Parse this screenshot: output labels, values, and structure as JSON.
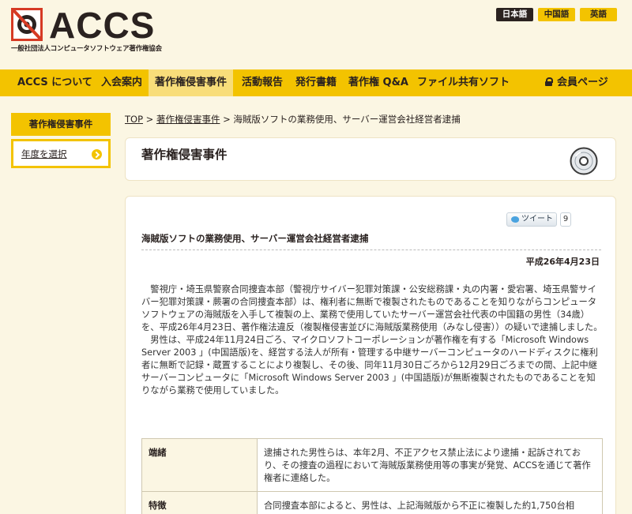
{
  "header": {
    "logo_text": "ACCS",
    "logo_sub": "一般社団法人コンピュータソフトウェア著作権協会",
    "languages": [
      "日本語",
      "中国語",
      "英語"
    ]
  },
  "nav": {
    "items": [
      "ACCS について",
      "入会案内",
      "著作権侵害事件",
      "活動報告",
      "発行書籍",
      "著作権 Q&A",
      "ファイル共有ソフト"
    ],
    "members": "会員ページ"
  },
  "sidebar": {
    "title": "著作権侵害事件",
    "year_select": "年度を選択"
  },
  "breadcrumb": {
    "top": "TOP",
    "sep1": " > ",
    "section": "著作権侵害事件",
    "sep2": " > ",
    "current": "海賊版ソフトの業務使用、サーバー運営会社経営者逮捕"
  },
  "page_title": "著作権侵害事件",
  "article": {
    "tweet_label": "ツイート",
    "tweet_count": "9",
    "headline": "海賊版ソフトの業務使用、サーバー運営会社経営者逮捕",
    "date": "平成26年4月23日",
    "paragraphs": [
      "警視庁・埼玉県警察合同捜査本部（警視庁サイバー犯罪対策課・公安総務課・丸の内署・愛宕署、埼玉県警サイバー犯罪対策課・蕨署の合同捜査本部）は、権利者に無断で複製されたものであることを知りながらコンピュータソフトウェアの海賊版を入手して複製の上、業務で使用していたサーバー運営会社代表の中国籍の男性（34歳）を、平成26年4月23日、著作権法違反（複製権侵害並びに海賊版業務使用（みなし侵害））の疑いで逮捕しました。",
      "男性は、平成24年11月24日ごろ、マイクロソフトコーポレーションが著作権を有する「Microsoft Windows Server 2003 」(中国語版)を、経営する法人が所有・管理する中継サーバーコンピュータのハードディスクに権利者に無断で記録・蔵置することにより複製し、その後、同年11月30日ごろから12月29日ごろまでの間、上記中継サーバーコンピュータに「Microsoft Windows Server 2003 」(中国語版)が無断複製されたものであることを知りながら業務で使用していました。"
    ],
    "table": [
      {
        "key": "端緒",
        "value": "逮捕された男性らは、本年2月、不正アクセス禁止法により逮捕・起訴されており、その捜査の過程において海賊版業務使用等の事実が発覚、ACCSを通じて著作権者に連絡した。"
      },
      {
        "key": "特徴",
        "value": "合同捜査本部によると、男性は、上記海賊版から不正に複製した約1,750台相"
      }
    ]
  },
  "colors": {
    "accent": "#f3c300",
    "background": "#fbf6e3",
    "logo_red": "#d63a24"
  }
}
